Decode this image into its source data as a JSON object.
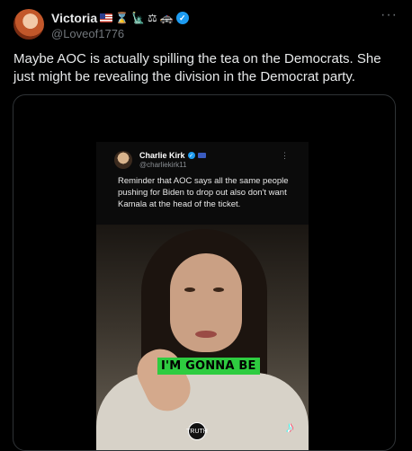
{
  "author": {
    "name": "Victoria",
    "handle": "@Loveof1776",
    "emoji_icons": [
      "flag-us-icon",
      "hourglass-icon",
      "statue-of-liberty-icon",
      "scales-icon",
      "police-car-icon"
    ],
    "verified": true
  },
  "tweet": {
    "text": "Maybe AOC is actually spilling the tea on the Democrats. She just might be revealing the division in the Democrat party."
  },
  "media": {
    "embedded_tweet": {
      "name": "Charlie Kirk",
      "handle": "@charliekirk11",
      "text": "Reminder that AOC says all the same people pushing for Biden to drop out also don't want Kamala at the head of the ticket."
    },
    "caption": "I'M GONNA BE",
    "watermark_text": "TRUTH"
  },
  "colors": {
    "background": "#000000",
    "text_primary": "#e7e9ea",
    "text_secondary": "#71767b",
    "accent_blue": "#1d9bf0",
    "caption_green": "#2ecc40"
  }
}
